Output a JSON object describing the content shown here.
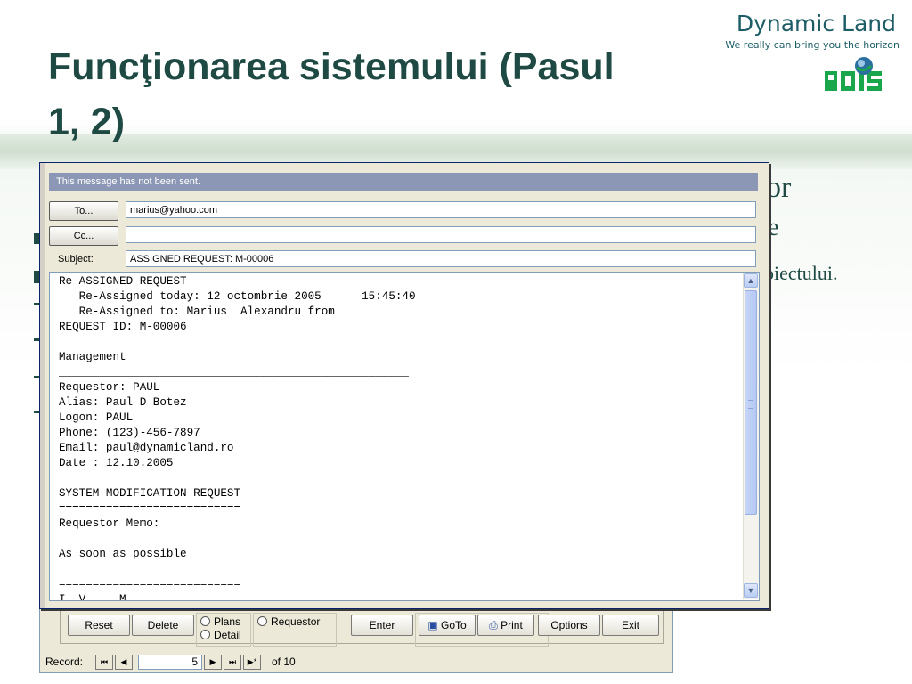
{
  "slide": {
    "title_line1": "Funcţionarea sistemului (Pasul",
    "title_line2": "1, 2)",
    "brand_name": "Dynamic Land",
    "brand_tagline": "We really can bring you the horizon",
    "bg_fragments": [
      "or",
      "e",
      "oiectului."
    ]
  },
  "mail": {
    "info_bar": "This message has not been sent.",
    "to_button": "To...",
    "cc_button": "Cc...",
    "to_value": "marius@yahoo.com",
    "cc_value": "",
    "subject_label": "Subject:",
    "subject_value": "ASSIGNED REQUEST: M-00006",
    "body_lines": [
      "Re-ASSIGNED REQUEST",
      "   Re-Assigned today: 12 octombrie 2005      15:45:40",
      "   Re-Assigned to: Marius  Alexandru from",
      "REQUEST ID: M-00006",
      "____________________________________________________",
      "Management",
      "____________________________________________________",
      "Requestor: PAUL",
      "Alias: Paul D Botez",
      "Logon: PAUL",
      "Phone: (123)-456-7897",
      "Email: paul@dynamicland.ro",
      "Date : 12.10.2005",
      "",
      "SYSTEM MODIFICATION REQUEST",
      "===========================",
      "Requestor Memo:",
      "",
      "As soon as possible",
      "",
      "===========================",
      "I  V     M"
    ]
  },
  "form": {
    "buttons": {
      "reset": "Reset",
      "delete": "Delete",
      "enter": "Enter",
      "goto": "GoTo",
      "print": "Print",
      "options": "Options",
      "exit": "Exit"
    },
    "radios": {
      "plans": "Plans",
      "detail": "Detail",
      "requestor": "Requestor"
    },
    "record": {
      "label": "Record:",
      "current": "5",
      "of_label": "of",
      "total": "10"
    }
  }
}
